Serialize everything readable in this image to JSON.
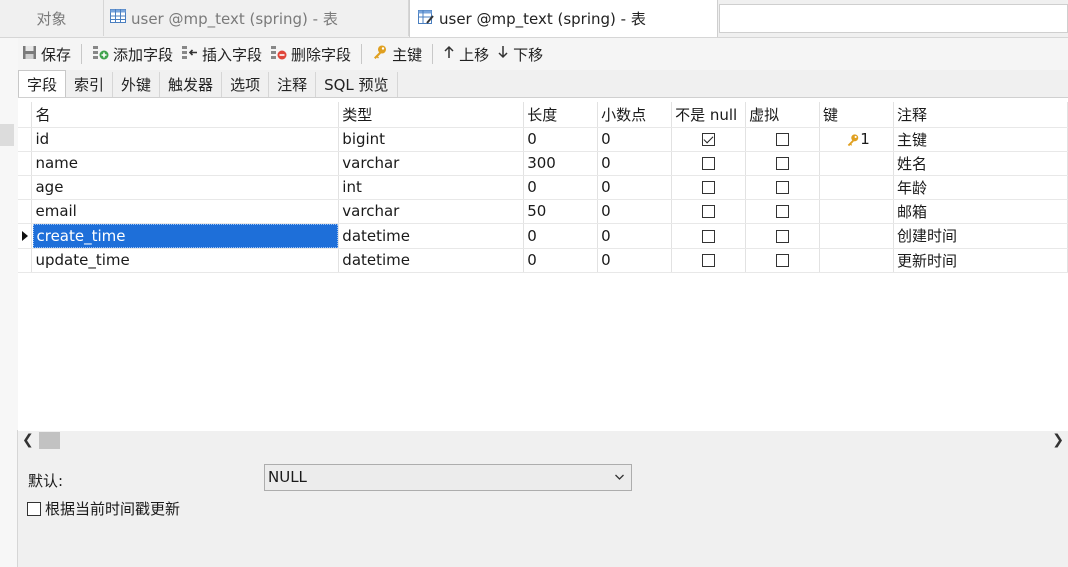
{
  "tabs": {
    "objects": "对象",
    "design1": "user @mp_text (spring) - 表",
    "design2": "user @mp_text (spring) - 表"
  },
  "toolbar": {
    "save": "保存",
    "add_field": "添加字段",
    "insert_field": "插入字段",
    "delete_field": "删除字段",
    "primary_key": "主键",
    "move_up": "上移",
    "move_down": "下移"
  },
  "subtabs": [
    "字段",
    "索引",
    "外键",
    "触发器",
    "选项",
    "注释",
    "SQL 预览"
  ],
  "columns": {
    "name": "名",
    "type": "类型",
    "length": "长度",
    "decimals": "小数点",
    "not_null": "不是 null",
    "virtual": "虚拟",
    "key": "键",
    "comment": "注释"
  },
  "rows": [
    {
      "name": "id",
      "type": "bigint",
      "length": "0",
      "decimals": "0",
      "not_null": true,
      "virtual": false,
      "key": "1",
      "comment": "主键"
    },
    {
      "name": "name",
      "type": "varchar",
      "length": "300",
      "decimals": "0",
      "not_null": false,
      "virtual": false,
      "key": "",
      "comment": "姓名"
    },
    {
      "name": "age",
      "type": "int",
      "length": "0",
      "decimals": "0",
      "not_null": false,
      "virtual": false,
      "key": "",
      "comment": "年龄"
    },
    {
      "name": "email",
      "type": "varchar",
      "length": "50",
      "decimals": "0",
      "not_null": false,
      "virtual": false,
      "key": "",
      "comment": "邮箱"
    },
    {
      "name": "create_time",
      "type": "datetime",
      "length": "0",
      "decimals": "0",
      "not_null": false,
      "virtual": false,
      "key": "",
      "comment": "创建时间"
    },
    {
      "name": "update_time",
      "type": "datetime",
      "length": "0",
      "decimals": "0",
      "not_null": false,
      "virtual": false,
      "key": "",
      "comment": "更新时间"
    }
  ],
  "props": {
    "default_label": "默认:",
    "default_value": "NULL",
    "update_on_current_label": "根据当前时间戳更新"
  },
  "colors": {
    "selection": "#1e6fd9",
    "key_icon": "#e0a020"
  },
  "icons": {
    "save": "save-icon",
    "add_field": "add-field-icon",
    "insert_field": "insert-field-icon",
    "delete_field": "delete-field-icon",
    "primary_key": "key-icon",
    "move_up": "arrow-up-icon",
    "move_down": "arrow-down-icon"
  }
}
